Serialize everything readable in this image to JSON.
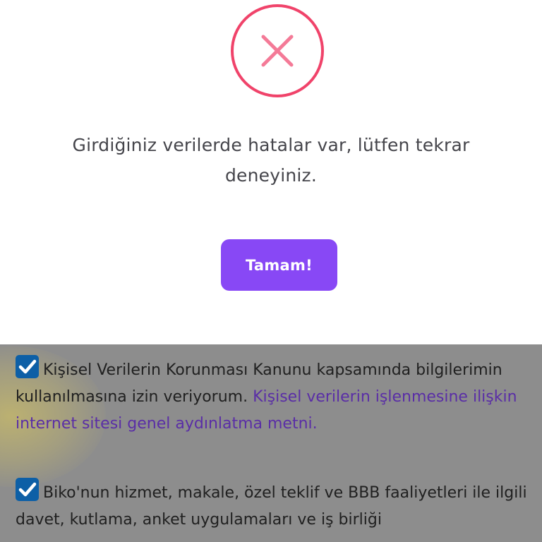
{
  "modal": {
    "icon": "error-x-icon",
    "icon_color": "#f0436a",
    "message": "Girdiğiniz verilerde hatalar var, lütfen tekrar deneyiniz.",
    "confirm_label": "Tamam!",
    "confirm_color": "#8848f5"
  },
  "consents": [
    {
      "checked": true,
      "text": "Kişisel Verilerin Korunması Kanunu kapsamında bilgilerimin kullanılmasına izin veriyorum.",
      "link_text": "Kişisel verilerin işlenmesine ilişkin internet sitesi genel aydınlatma metni."
    },
    {
      "checked": true,
      "text": "Biko'nun hizmet, makale, özel teklif ve BBB faaliyetleri ile ilgili davet, kutlama, anket uygulamaları ve iş birliği"
    }
  ],
  "colors": {
    "overlay": "#8d8d8d",
    "link": "#5a2ea6",
    "checkbox": "#0d5fa6"
  }
}
